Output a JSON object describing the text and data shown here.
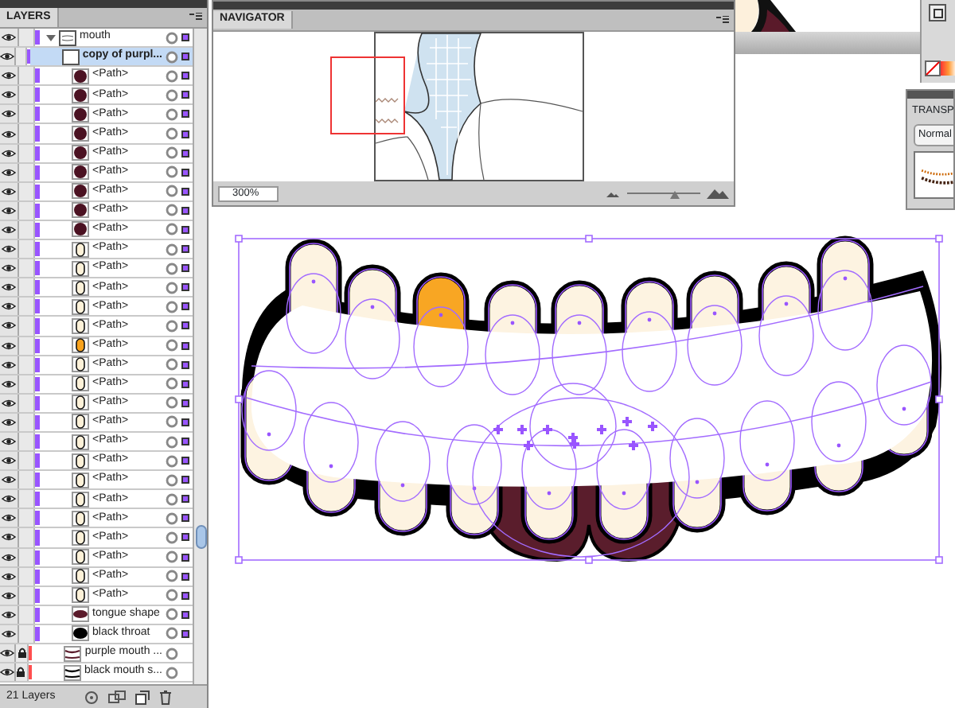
{
  "layers_panel": {
    "tab": "LAYERS",
    "rows": [
      {
        "name": "mouth",
        "kind": "group",
        "visible": true,
        "locked": false,
        "color": "#9955ff",
        "art_selected": true,
        "selected": false,
        "expanded": true,
        "children": [
          {
            "name": "copy of purpl...",
            "kind": "blank",
            "visible": true,
            "locked": false,
            "color": "#9955ff",
            "art_selected": true,
            "selected": true
          },
          {
            "name": "<Path>",
            "kind": "dot",
            "visible": true,
            "locked": false,
            "color": "#9955ff",
            "art_selected": true,
            "selected": false
          },
          {
            "name": "<Path>",
            "kind": "dot",
            "visible": true,
            "locked": false,
            "color": "#9955ff",
            "art_selected": true,
            "selected": false
          },
          {
            "name": "<Path>",
            "kind": "dot",
            "visible": true,
            "locked": false,
            "color": "#9955ff",
            "art_selected": true,
            "selected": false
          },
          {
            "name": "<Path>",
            "kind": "dot",
            "visible": true,
            "locked": false,
            "color": "#9955ff",
            "art_selected": true,
            "selected": false
          },
          {
            "name": "<Path>",
            "kind": "dot",
            "visible": true,
            "locked": false,
            "color": "#9955ff",
            "art_selected": true,
            "selected": false
          },
          {
            "name": "<Path>",
            "kind": "dot",
            "visible": true,
            "locked": false,
            "color": "#9955ff",
            "art_selected": true,
            "selected": false
          },
          {
            "name": "<Path>",
            "kind": "dot",
            "visible": true,
            "locked": false,
            "color": "#9955ff",
            "art_selected": true,
            "selected": false
          },
          {
            "name": "<Path>",
            "kind": "dot",
            "visible": true,
            "locked": false,
            "color": "#9955ff",
            "art_selected": true,
            "selected": false
          },
          {
            "name": "<Path>",
            "kind": "dot",
            "visible": true,
            "locked": false,
            "color": "#9955ff",
            "art_selected": true,
            "selected": false
          },
          {
            "name": "<Path>",
            "kind": "tooth",
            "visible": true,
            "locked": false,
            "color": "#9955ff",
            "art_selected": true,
            "selected": false
          },
          {
            "name": "<Path>",
            "kind": "tooth",
            "visible": true,
            "locked": false,
            "color": "#9955ff",
            "art_selected": true,
            "selected": false
          },
          {
            "name": "<Path>",
            "kind": "tooth",
            "visible": true,
            "locked": false,
            "color": "#9955ff",
            "art_selected": true,
            "selected": false
          },
          {
            "name": "<Path>",
            "kind": "tooth",
            "visible": true,
            "locked": false,
            "color": "#9955ff",
            "art_selected": true,
            "selected": false
          },
          {
            "name": "<Path>",
            "kind": "tooth",
            "visible": true,
            "locked": false,
            "color": "#9955ff",
            "art_selected": true,
            "selected": false
          },
          {
            "name": "<Path>",
            "kind": "orange-tooth",
            "visible": true,
            "locked": false,
            "color": "#9955ff",
            "art_selected": true,
            "selected": false
          },
          {
            "name": "<Path>",
            "kind": "tooth",
            "visible": true,
            "locked": false,
            "color": "#9955ff",
            "art_selected": true,
            "selected": false
          },
          {
            "name": "<Path>",
            "kind": "tooth",
            "visible": true,
            "locked": false,
            "color": "#9955ff",
            "art_selected": true,
            "selected": false
          },
          {
            "name": "<Path>",
            "kind": "tooth",
            "visible": true,
            "locked": false,
            "color": "#9955ff",
            "art_selected": true,
            "selected": false
          },
          {
            "name": "<Path>",
            "kind": "tooth",
            "visible": true,
            "locked": false,
            "color": "#9955ff",
            "art_selected": true,
            "selected": false
          },
          {
            "name": "<Path>",
            "kind": "tooth",
            "visible": true,
            "locked": false,
            "color": "#9955ff",
            "art_selected": true,
            "selected": false
          },
          {
            "name": "<Path>",
            "kind": "tooth",
            "visible": true,
            "locked": false,
            "color": "#9955ff",
            "art_selected": true,
            "selected": false
          },
          {
            "name": "<Path>",
            "kind": "tooth",
            "visible": true,
            "locked": false,
            "color": "#9955ff",
            "art_selected": true,
            "selected": false
          },
          {
            "name": "<Path>",
            "kind": "tooth",
            "visible": true,
            "locked": false,
            "color": "#9955ff",
            "art_selected": true,
            "selected": false
          },
          {
            "name": "<Path>",
            "kind": "tooth",
            "visible": true,
            "locked": false,
            "color": "#9955ff",
            "art_selected": true,
            "selected": false
          },
          {
            "name": "<Path>",
            "kind": "tooth",
            "visible": true,
            "locked": false,
            "color": "#9955ff",
            "art_selected": true,
            "selected": false
          },
          {
            "name": "<Path>",
            "kind": "tooth",
            "visible": true,
            "locked": false,
            "color": "#9955ff",
            "art_selected": true,
            "selected": false
          },
          {
            "name": "<Path>",
            "kind": "tooth",
            "visible": true,
            "locked": false,
            "color": "#9955ff",
            "art_selected": true,
            "selected": false
          },
          {
            "name": "<Path>",
            "kind": "tooth",
            "visible": true,
            "locked": false,
            "color": "#9955ff",
            "art_selected": true,
            "selected": false
          },
          {
            "name": "tongue shape",
            "kind": "tongue",
            "visible": true,
            "locked": false,
            "color": "#9955ff",
            "art_selected": true,
            "selected": false
          },
          {
            "name": "black throat",
            "kind": "throat",
            "visible": true,
            "locked": false,
            "color": "#9955ff",
            "art_selected": true,
            "selected": false
          },
          {
            "name": "purple mouth ...",
            "kind": "mouth-purple",
            "visible": true,
            "locked": true,
            "color": "#ff4f4f",
            "art_selected": false,
            "selected": false
          },
          {
            "name": "black mouth s...",
            "kind": "mouth-black",
            "visible": true,
            "locked": true,
            "color": "#ff4f4f",
            "art_selected": false,
            "selected": false
          }
        ]
      }
    ],
    "footer_count": "21 Layers"
  },
  "navigator": {
    "tab": "NAVIGATOR",
    "zoom": "300%",
    "level": 0.65
  },
  "transparency_panel": {
    "tab": "TRANSP",
    "blend_mode": "Normal"
  }
}
